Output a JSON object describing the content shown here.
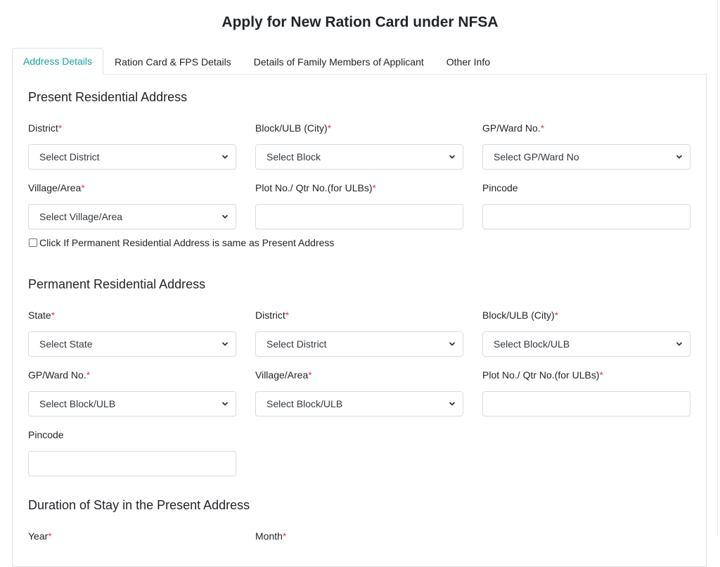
{
  "page": {
    "title": "Apply for New Ration Card under NFSA"
  },
  "tabs": [
    {
      "label": "Address Details",
      "active": true
    },
    {
      "label": "Ration Card & FPS Details",
      "active": false
    },
    {
      "label": "Details of Family Members of Applicant",
      "active": false
    },
    {
      "label": "Other Info",
      "active": false
    }
  ],
  "colors": {
    "accent": "#1aa394",
    "required": "#e0424e",
    "border": "#dee2e6"
  },
  "present_address": {
    "title": "Present Residential Address",
    "district": {
      "label": "District",
      "required_mark": "*",
      "value": "Select District"
    },
    "block": {
      "label": "Block/ULB (City)",
      "required_mark": "*",
      "value": "Select Block"
    },
    "gp_ward": {
      "label": "GP/Ward No.",
      "required_mark": "*",
      "value": "Select GP/Ward No"
    },
    "village": {
      "label": "Village/Area",
      "required_mark": "*",
      "value": "Select Village/Area"
    },
    "plot": {
      "label": "Plot No./ Qtr No.(for ULBs)",
      "required_mark": "*",
      "value": ""
    },
    "pincode": {
      "label": "Pincode",
      "value": ""
    },
    "same_as_checkbox": {
      "label": "Click If Permanent Residential Address is same as Present Address",
      "checked": false
    }
  },
  "permanent_address": {
    "title": "Permanent Residential Address",
    "state": {
      "label": "State",
      "required_mark": "*",
      "value": "Select State"
    },
    "district": {
      "label": "District",
      "required_mark": "*",
      "value": "Select District"
    },
    "block": {
      "label": "Block/ULB (City)",
      "required_mark": "*",
      "value": "Select Block/ULB"
    },
    "gp_ward": {
      "label": "GP/Ward No.",
      "required_mark": "*",
      "value": "Select Block/ULB"
    },
    "village": {
      "label": "Village/Area",
      "required_mark": "*",
      "value": "Select Block/ULB"
    },
    "plot": {
      "label": "Plot No./ Qtr No.(for ULBs)",
      "required_mark": "*",
      "value": ""
    },
    "pincode": {
      "label": "Pincode",
      "value": ""
    }
  },
  "duration": {
    "title": "Duration of Stay in the Present Address",
    "year": {
      "label": "Year",
      "required_mark": "*"
    },
    "month": {
      "label": "Month",
      "required_mark": "*"
    }
  }
}
